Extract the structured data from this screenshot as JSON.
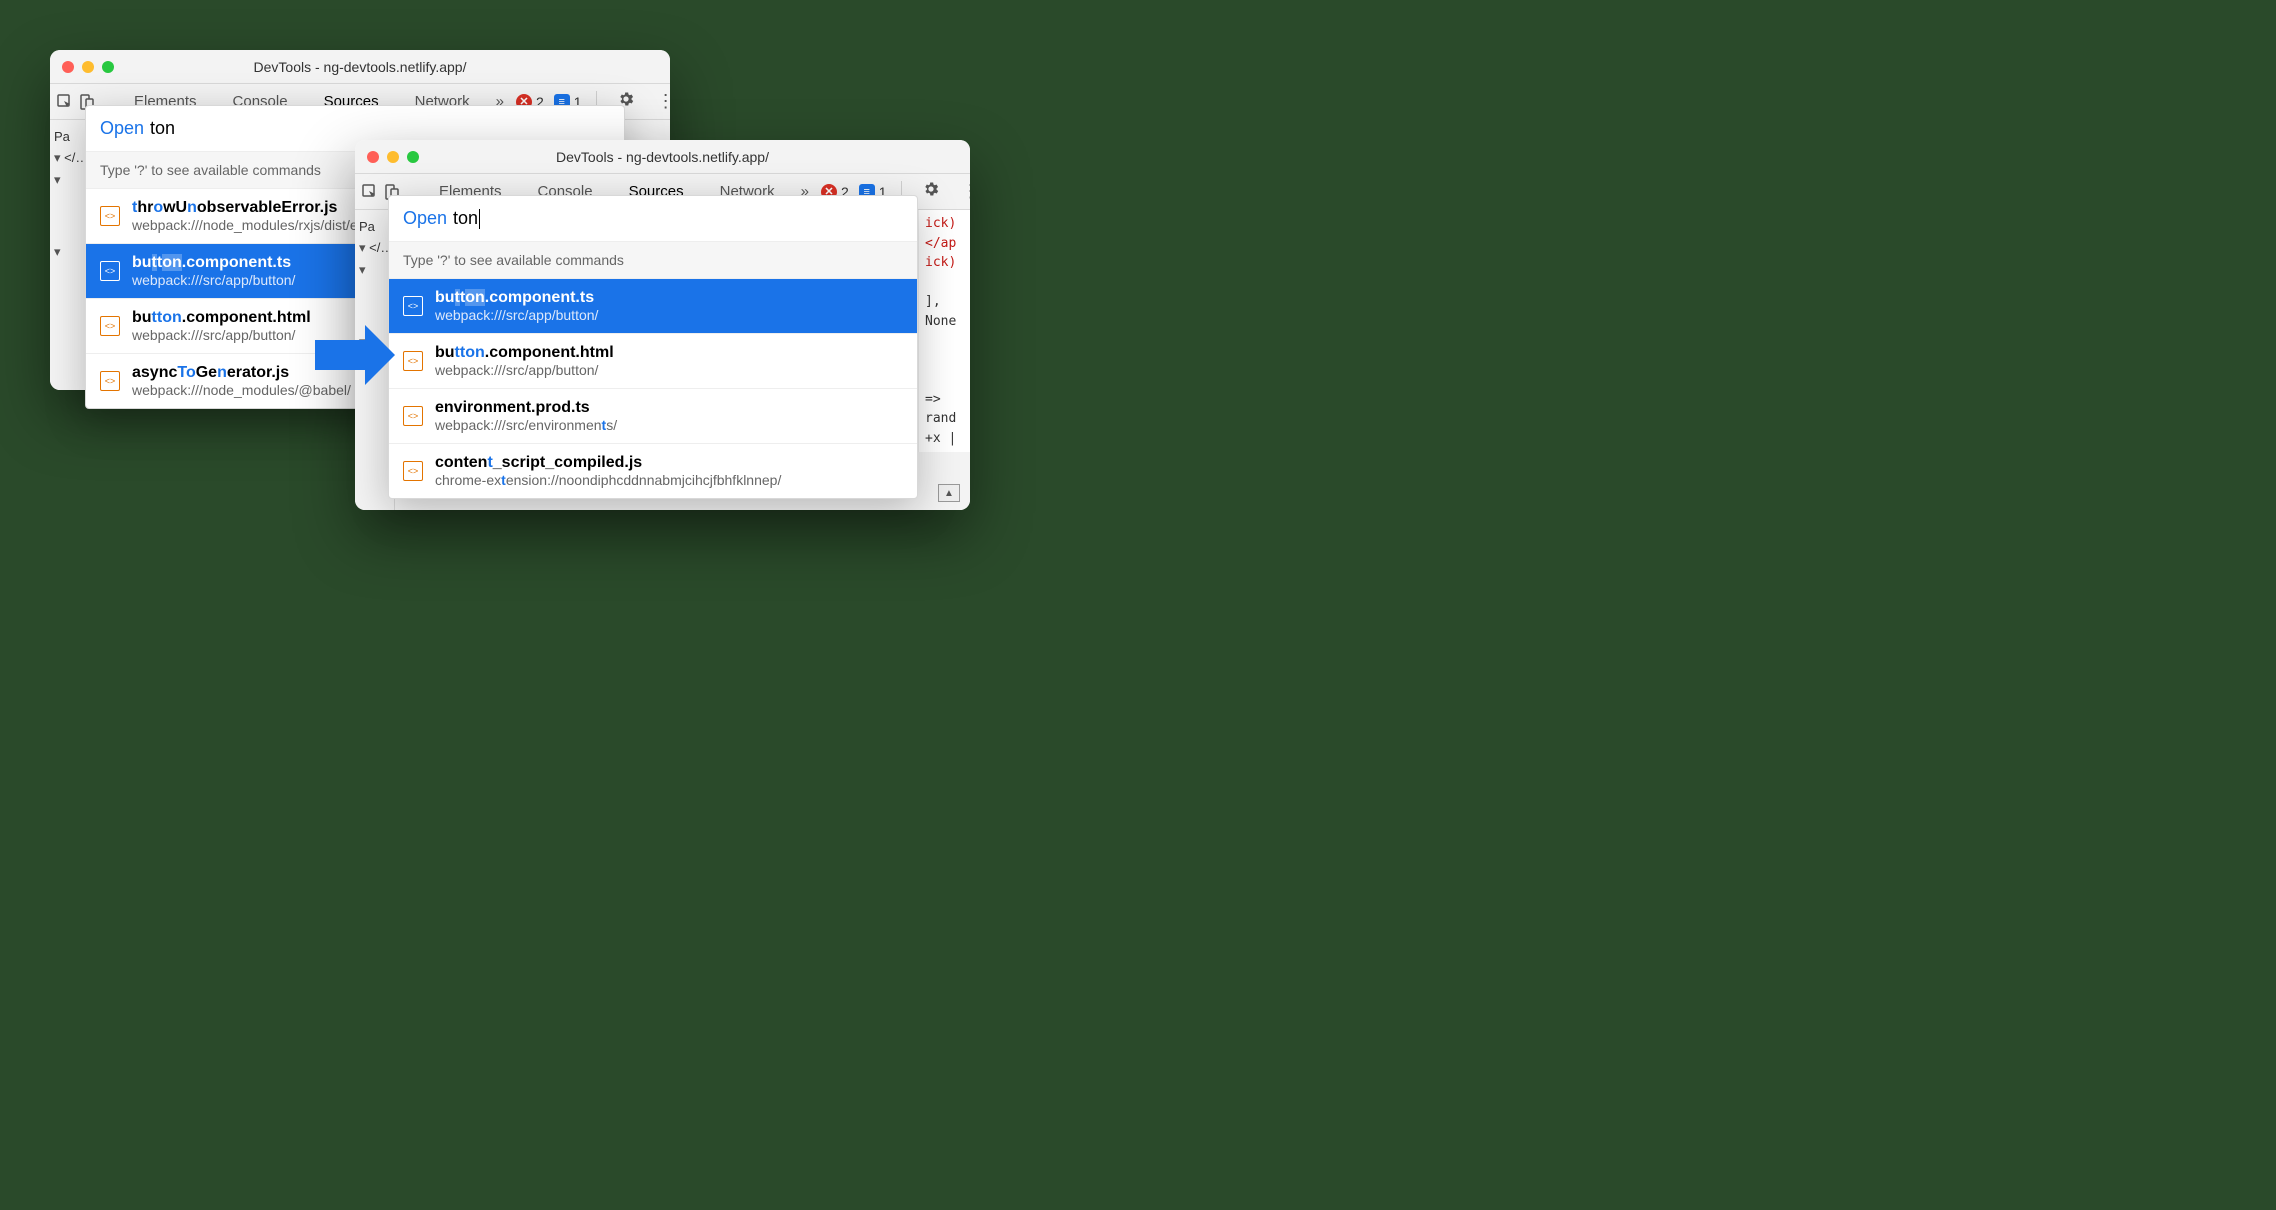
{
  "windowA": {
    "title": "DevTools - ng-devtools.netlify.app/",
    "tabs": {
      "t0": "Elements",
      "t1": "Console",
      "t2": "Sources",
      "t3": "Network",
      "more": "»"
    },
    "errors": "2",
    "messages": "1",
    "panel_hint": "Pa",
    "tree": {
      "r0": "</…",
      "r1": ""
    },
    "qo": {
      "open": "Open",
      "query": "ton",
      "hint": "Type '?' to see available commands",
      "results": [
        {
          "name_html": "<span class='hl'>t</span>hr<span class='hl'>o</span>wU<span class='hl'>n</span>observableError.js",
          "sub_html": "webpack:///node_modules/rxjs/dist/esm",
          "selected": false
        },
        {
          "name_html": "bu<span class='hl'>t</span>t<span class='hl'>on</span>.component.ts",
          "sub_html": "webpack:///src/app/button/",
          "selected": true
        },
        {
          "name_html": "bu<span class='hl'>t</span><span class='hl'>ton</span>.component.html",
          "sub_html": "webpack:///src/app/button/",
          "selected": false
        },
        {
          "name_html": "async<span class='hl'>To</span>Ge<span class='hl'>n</span>erator.js",
          "sub_html": "webpack:///node_modules/@babel/",
          "selected": false
        }
      ]
    }
  },
  "windowB": {
    "title": "DevTools - ng-devtools.netlify.app/",
    "tabs": {
      "t0": "Elements",
      "t1": "Console",
      "t2": "Sources",
      "t3": "Network",
      "more": "»"
    },
    "errors": "2",
    "messages": "1",
    "panel_hint": "Pa",
    "tree": {
      "r0": "</…",
      "r1": ""
    },
    "code_lines": [
      {
        "cls": "code-red",
        "text": "ick)"
      },
      {
        "cls": "code-red",
        "text": "</ap"
      },
      {
        "cls": "code-red",
        "text": "ick)"
      },
      {
        "cls": "",
        "text": ""
      },
      {
        "cls": "",
        "text": "],"
      },
      {
        "cls": "",
        "text": "None"
      },
      {
        "cls": "",
        "text": ""
      },
      {
        "cls": "",
        "text": ""
      },
      {
        "cls": "",
        "text": ""
      },
      {
        "cls": "",
        "text": " =>"
      },
      {
        "cls": "",
        "text": "rand"
      },
      {
        "cls": "",
        "text": "+x  |"
      }
    ],
    "qo": {
      "open": "Open",
      "query": "ton",
      "hint": "Type '?' to see available commands",
      "results": [
        {
          "name_html": "bu<span class='hl'>t</span>t<span class='hl'>on</span>.component.ts",
          "sub_html": "webpack:///src/app/button/",
          "selected": true
        },
        {
          "name_html": "bu<span class='hl'>t</span><span class='hl'>ton</span>.component.html",
          "sub_html": "webpack:///src/app/button/",
          "selected": false
        },
        {
          "name_html": "environment.prod.ts",
          "sub_html": "webpack:///src/environmen<span class='hl'>t</span>s/",
          "selected": false
        },
        {
          "name_html": "conten<span class='hl'>t</span>_script_compiled.js",
          "sub_html": "chrome-ex<span class='hl'>t</span>ension://noondiphcddnnabmjcihcjfbhfklnnep/",
          "selected": false
        }
      ]
    }
  }
}
